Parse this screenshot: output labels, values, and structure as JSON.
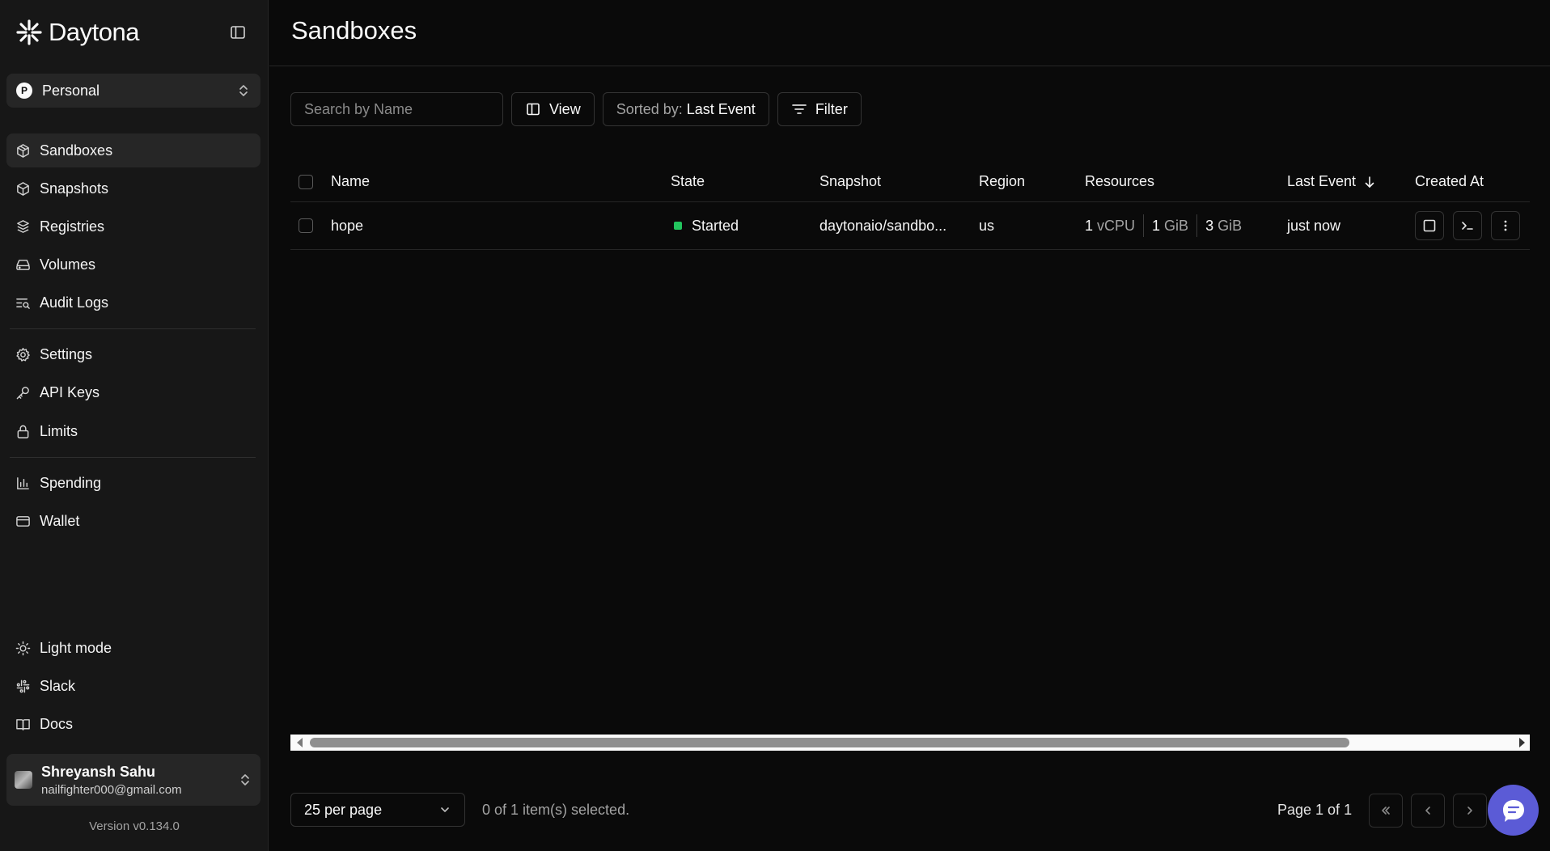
{
  "app": {
    "name": "Daytona",
    "version": "Version v0.134.0"
  },
  "sidebar": {
    "org": {
      "badge": "P",
      "name": "Personal"
    },
    "items": [
      {
        "label": "Sandboxes",
        "icon": "box-icon"
      },
      {
        "label": "Snapshots",
        "icon": "cube-icon"
      },
      {
        "label": "Registries",
        "icon": "boxes-icon"
      },
      {
        "label": "Volumes",
        "icon": "hard-drive-icon"
      },
      {
        "label": "Audit Logs",
        "icon": "text-search-icon"
      },
      {
        "label": "Settings",
        "icon": "gear-icon"
      },
      {
        "label": "API Keys",
        "icon": "key-icon"
      },
      {
        "label": "Limits",
        "icon": "lock-icon"
      },
      {
        "label": "Spending",
        "icon": "bar-chart-icon"
      },
      {
        "label": "Wallet",
        "icon": "credit-card-icon"
      }
    ],
    "bottom": [
      {
        "label": "Light mode",
        "icon": "sun-icon"
      },
      {
        "label": "Slack",
        "icon": "slack-icon"
      },
      {
        "label": "Docs",
        "icon": "book-icon"
      }
    ],
    "user": {
      "name": "Shreyansh Sahu",
      "email": "nailfighter000@gmail.com"
    }
  },
  "main": {
    "title": "Sandboxes",
    "toolbar": {
      "search_placeholder": "Search by Name",
      "view_label": "View",
      "sort_prefix": "Sorted by:",
      "sort_value": "Last Event",
      "filter_label": "Filter"
    },
    "table": {
      "columns": [
        "Name",
        "State",
        "Snapshot",
        "Region",
        "Resources",
        "Last Event",
        "Created At"
      ],
      "rows": [
        {
          "name": "hope",
          "state": "Started",
          "state_color": "#22c55e",
          "snapshot": "daytonaio/sandbo...",
          "region": "us",
          "cpu": "1",
          "cpu_unit": "vCPU",
          "mem": "1",
          "mem_unit": "GiB",
          "disk": "3",
          "disk_unit": "GiB",
          "last_event": "just now"
        }
      ]
    },
    "footer": {
      "per_page": "25 per page",
      "selected": "0 of 1 item(s) selected.",
      "page": "Page 1 of 1"
    }
  }
}
